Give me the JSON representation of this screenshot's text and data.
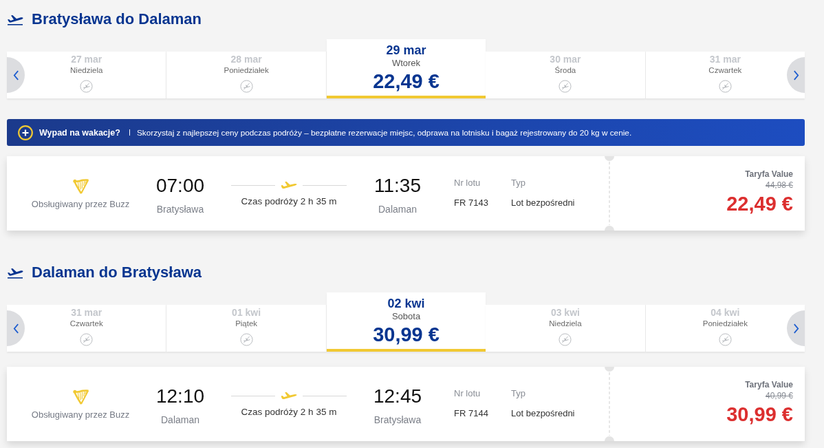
{
  "sections": [
    {
      "title": "Bratysława do Dalaman",
      "dates": [
        {
          "date": "27 mar",
          "weekday": "Niedziela",
          "selected": false
        },
        {
          "date": "28 mar",
          "weekday": "Poniedziałek",
          "selected": false
        },
        {
          "date": "29 mar",
          "weekday": "Wtorek",
          "price": "22,49 €",
          "selected": true
        },
        {
          "date": "30 mar",
          "weekday": "Środa",
          "selected": false
        },
        {
          "date": "31 mar",
          "weekday": "Czwartek",
          "selected": false
        }
      ],
      "promo": {
        "title": "Wypad na wakacje?",
        "text": "Skorzystaj z najlepszej ceny podczas podróży – bezpłatne rezerwacje miejsc, odprawa na lotnisku i bagaż rejestrowany do 20 kg w cenie."
      },
      "flight": {
        "operator": "Obsługiwany przez Buzz",
        "departure_time": "07:00",
        "departure_city": "Bratysława",
        "duration": "Czas podróży 2 h 35 m",
        "arrival_time": "11:35",
        "arrival_city": "Dalaman",
        "flight_no_label": "Nr lotu",
        "flight_no": "FR 7143",
        "type_label": "Typ",
        "type": "Lot bezpośredni",
        "fare_name": "Taryfa Value",
        "old_price": "44,98 €",
        "price": "22,49 €"
      }
    },
    {
      "title": "Dalaman do Bratysława",
      "dates": [
        {
          "date": "31 mar",
          "weekday": "Czwartek",
          "selected": false
        },
        {
          "date": "01 kwi",
          "weekday": "Piątek",
          "selected": false
        },
        {
          "date": "02 kwi",
          "weekday": "Sobota",
          "price": "30,99 €",
          "selected": true
        },
        {
          "date": "03 kwi",
          "weekday": "Niedziela",
          "selected": false
        },
        {
          "date": "04 kwi",
          "weekday": "Poniedziałek",
          "selected": false
        }
      ],
      "flight": {
        "operator": "Obsługiwany przez Buzz",
        "departure_time": "12:10",
        "departure_city": "Dalaman",
        "duration": "Czas podróży 2 h 35 m",
        "arrival_time": "12:45",
        "arrival_city": "Bratysława",
        "flight_no_label": "Nr lotu",
        "flight_no": "FR 7144",
        "type_label": "Typ",
        "type": "Lot bezpośredni",
        "fare_name": "Taryfa Value",
        "old_price": "40,99 €",
        "price": "30,99 €"
      }
    }
  ]
}
